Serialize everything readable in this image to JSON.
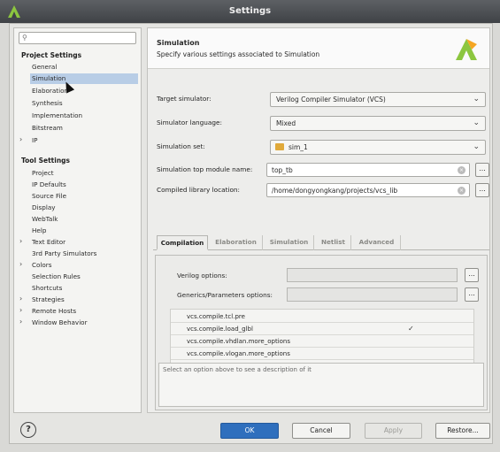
{
  "window": {
    "title": "Settings"
  },
  "search": {
    "placeholder": ""
  },
  "sidebar": {
    "project_section": "Project Settings",
    "project_items": [
      "General",
      "Simulation",
      "Elaboration",
      "Synthesis",
      "Implementation",
      "Bitstream",
      "IP"
    ],
    "tool_section": "Tool Settings",
    "tool_items": [
      "Project",
      "IP Defaults",
      "Source File",
      "Display",
      "WebTalk",
      "Help",
      "Text Editor",
      "3rd Party Simulators",
      "Colors",
      "Selection Rules",
      "Shortcuts",
      "Strategies",
      "Remote Hosts",
      "Window Behavior"
    ],
    "selected": "Simulation"
  },
  "header": {
    "title": "Simulation",
    "description": "Specify various settings associated to Simulation"
  },
  "form": {
    "target_simulator_label": "Target simulator:",
    "target_simulator_value": "Verilog Compiler Simulator (VCS)",
    "language_label": "Simulator language:",
    "language_value": "Mixed",
    "sim_set_label": "Simulation set:",
    "sim_set_value": "sim_1",
    "top_module_label": "Simulation top module name:",
    "top_module_value": "top_tb",
    "compiled_lib_label": "Compiled library location:",
    "compiled_lib_value": "/home/dongyongkang/projects/vcs_lib",
    "dots": "..."
  },
  "tabs": [
    "Compilation",
    "Elaboration",
    "Simulation",
    "Netlist",
    "Advanced"
  ],
  "compilation": {
    "verilog_options_label": "Verilog options:",
    "generics_label": "Generics/Parameters options:",
    "options": [
      {
        "name": "vcs.compile.tcl.pre",
        "checked": false
      },
      {
        "name": "vcs.compile.load_glbl",
        "checked": true
      },
      {
        "name": "vcs.compile.vhdlan.more_options",
        "checked": false
      },
      {
        "name": "vcs.compile.vlogan.more_options",
        "checked": false
      }
    ],
    "description_hint": "Select an option above to see a description of it"
  },
  "buttons": {
    "ok": "OK",
    "cancel": "Cancel",
    "apply": "Apply",
    "restore": "Restore..."
  },
  "help": "?"
}
